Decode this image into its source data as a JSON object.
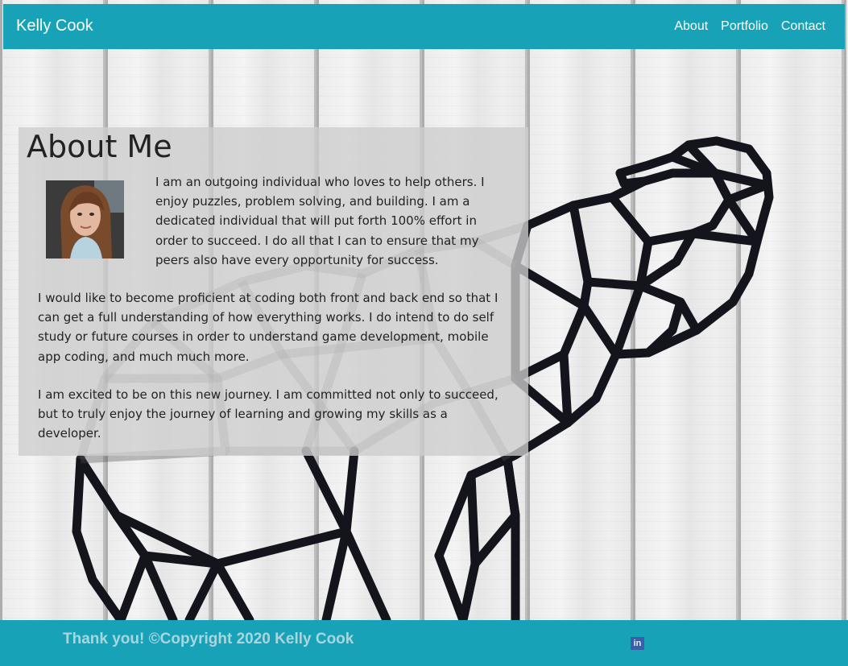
{
  "header": {
    "brand": "Kelly Cook",
    "nav": [
      {
        "label": "About"
      },
      {
        "label": "Portfolio"
      },
      {
        "label": "Contact"
      }
    ]
  },
  "about": {
    "title": "About Me",
    "paragraphs": [
      "I am an outgoing individual who loves to help others. I enjoy puzzles, problem solving, and building. I am a dedicated individual that will put forth 100% effort in order to succeed. I do all that I can to ensure that my peers also have every opportunity for success.",
      "I would like to become proficient at coding both front and back end so that I can get a full understanding of how everything works. I do intend to do self study or future courses in order to understand game development, mobile app coding, and much much more.",
      "I am excited to be on this new journey. I am committed not only to succeed, but to truly enjoy the journey of learning and growing my skills as a developer."
    ]
  },
  "footer": {
    "copyright": "Thank you! ©Copyright 2020 Kelly Cook",
    "social_icon": "linkedin-icon",
    "social_text": "in"
  },
  "colors": {
    "brand": "#17a2b8",
    "footer_text": "#a9d6de",
    "linkedin": "#3a5ea8"
  }
}
